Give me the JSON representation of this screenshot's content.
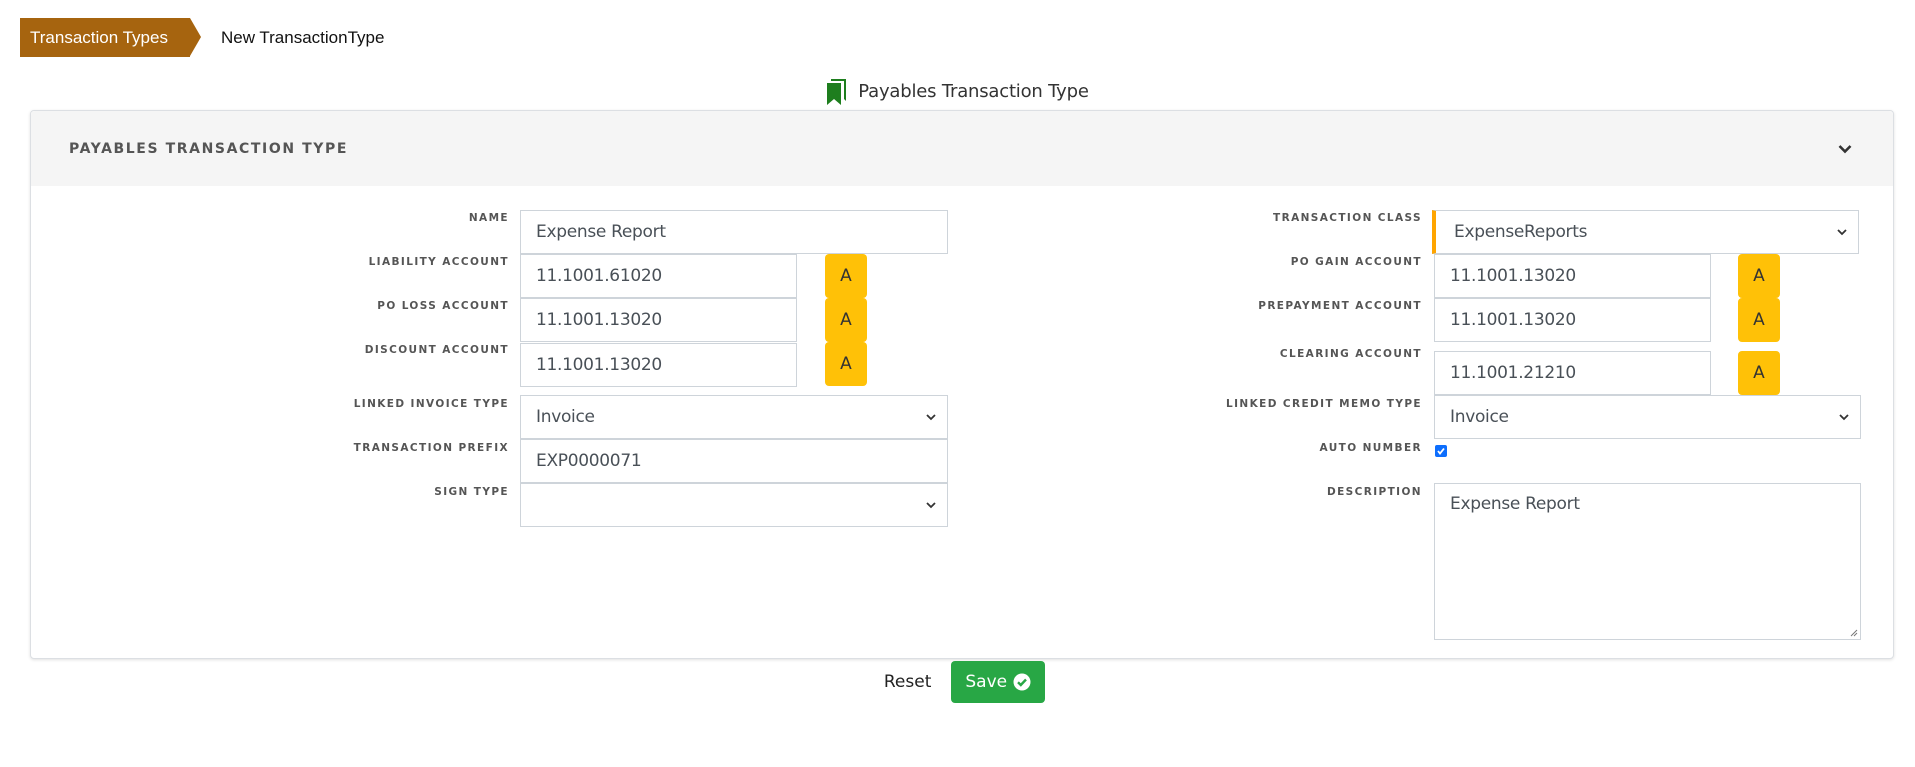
{
  "breadcrumb": {
    "parent": "Transaction Types",
    "current": "New TransactionType"
  },
  "page": {
    "title": "Payables Transaction Type",
    "icon": "bookmark-icon"
  },
  "panel": {
    "title": "PAYABLES TRANSACTION TYPE",
    "collapse_icon": "chevron-down-icon"
  },
  "left": {
    "name": {
      "label": "NAME",
      "value": "Expense Report"
    },
    "liability_account": {
      "label": "LIABILITY ACCOUNT",
      "value": "11.1001.61020",
      "button": "A"
    },
    "po_loss_account": {
      "label": "PO LOSS ACCOUNT",
      "value": "11.1001.13020",
      "button": "A"
    },
    "discount_account": {
      "label": "DISCOUNT ACCOUNT",
      "value": "11.1001.13020",
      "button": "A"
    },
    "linked_invoice_type": {
      "label": "LINKED INVOICE TYPE",
      "value": "Invoice"
    },
    "transaction_prefix": {
      "label": "TRANSACTION PREFIX",
      "value": "EXP0000071"
    },
    "sign_type": {
      "label": "SIGN TYPE",
      "value": ""
    }
  },
  "right": {
    "transaction_class": {
      "label": "TRANSACTION CLASS",
      "value": "ExpenseReports"
    },
    "po_gain_account": {
      "label": "PO GAIN ACCOUNT",
      "value": "11.1001.13020",
      "button": "A"
    },
    "prepayment_account": {
      "label": "PREPAYMENT ACCOUNT",
      "value": "11.1001.13020",
      "button": "A"
    },
    "clearing_account": {
      "label": "CLEARING ACCOUNT",
      "value": "11.1001.21210",
      "button": "A"
    },
    "linked_credit_memo_type": {
      "label": "LINKED CREDIT MEMO TYPE",
      "value": "Invoice"
    },
    "auto_number": {
      "label": "AUTO NUMBER",
      "checked": true
    },
    "description": {
      "label": "DESCRIPTION",
      "value": "Expense Report"
    }
  },
  "actions": {
    "reset": "Reset",
    "save": "Save"
  },
  "colors": {
    "breadcrumb": "#a6640f",
    "account_button": "#ffc107",
    "required_accent": "#ffa500",
    "save": "#28a745",
    "bookmark_icon": "#1e7e1e"
  }
}
